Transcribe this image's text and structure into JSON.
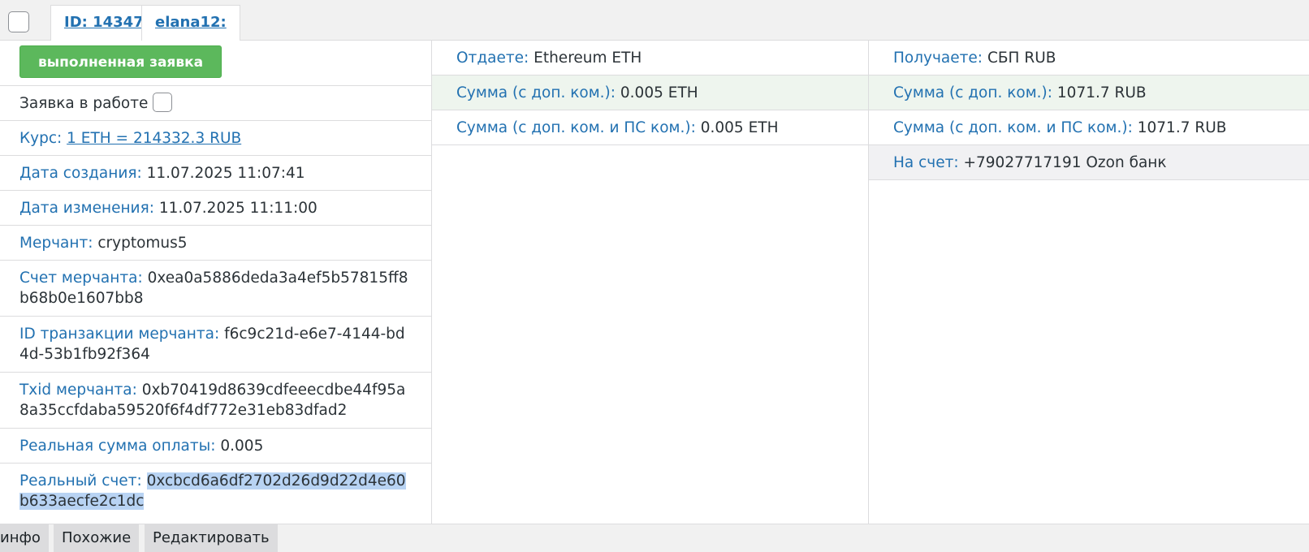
{
  "header": {
    "id_link": "ID: 14347",
    "user_link": "elana12:"
  },
  "left": {
    "status_button": "выполненная заявка",
    "in_work_label": "Заявка в работе",
    "rate_label": "Курс:",
    "rate_value": "1 ETH = 214332.3 RUB",
    "created_label": "Дата создания:",
    "created_value": "11.07.2025 11:07:41",
    "modified_label": "Дата изменения:",
    "modified_value": "11.07.2025 11:11:00",
    "merchant_label": "Мерчант:",
    "merchant_value": "cryptomus5",
    "merchant_account_label": "Счет мерчанта:",
    "merchant_account_value": "0xea0a5886deda3a4ef5b57815ff8b68b0e1607bb8",
    "merchant_tx_label": "ID транзакции мерчанта:",
    "merchant_tx_value": "f6c9c21d-e6e7-4144-bd4d-53b1fb92f364",
    "merchant_txid_label": "Txid мерчанта:",
    "merchant_txid_value": "0xb70419d8639cdfeeecdbe44f95a8a35ccfdaba59520f6f4df772e31eb83dfad2",
    "real_amount_label": "Реальная сумма оплаты:",
    "real_amount_value": "0.005",
    "real_account_label": "Реальный счет:",
    "real_account_value": "0xcbcd6a6df2702d26d9d22d4e60b633aecfe2c1dc"
  },
  "give": {
    "give_label": "Отдаете:",
    "give_value": "Ethereum ETH",
    "sum_label": "Сумма (с доп. ком.):",
    "sum_value": "0.005 ETH",
    "sum_ps_label": "Сумма (с доп. ком. и ПС ком.):",
    "sum_ps_value": "0.005 ETH"
  },
  "get": {
    "get_label": "Получаете:",
    "get_value": "СБП RUB",
    "sum_label": "Сумма (с доп. ком.):",
    "sum_value": "1071.7 RUB",
    "sum_ps_label": "Сумма (с доп. ком. и ПС ком.):",
    "sum_ps_value": "1071.7 RUB",
    "account_label": "На счет:",
    "account_value": "+79027717191 Ozon банк"
  },
  "footer": {
    "tab_info": "инфо",
    "tab_similar": "Похожие",
    "tab_edit": "Редактировать"
  }
}
